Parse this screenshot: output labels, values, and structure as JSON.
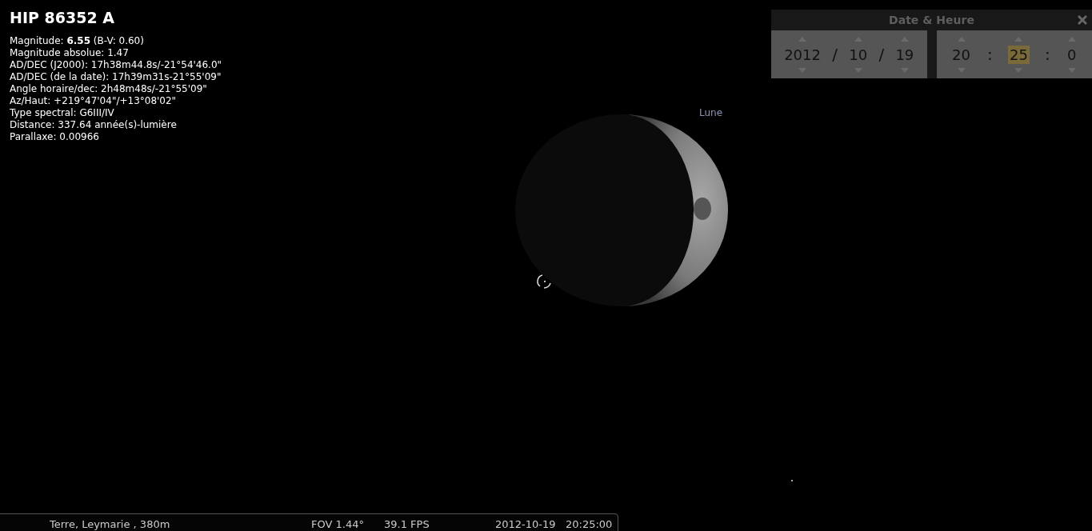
{
  "object_info": {
    "title": "HIP 86352 A",
    "lines": [
      "Magnitude: **6.55** (B-V: 0.60)",
      "Magnitude absolue: 1.47",
      "AD/DEC (J2000): 17h38m44.8s/-21°54'46.0\"",
      "AD/DEC (de la date): 17h39m31s-21°55'09\"",
      "Angle horaire/dec: 2h48m48s/-21°55'09\"",
      "Az/Haut: +219°47'04\"/+13°08'02\"",
      "Type spectral: G6III/IV",
      "Distance: 337.64 année(s)-lumière",
      "Parallaxe: 0.00966"
    ]
  },
  "moon": {
    "label": "Lune"
  },
  "date_dialog": {
    "title": "Date & Heure",
    "date_fields": [
      {
        "value": "2012",
        "selected": false
      },
      {
        "value": "10",
        "selected": false
      },
      {
        "value": "19",
        "selected": false
      }
    ],
    "date_separators": [
      "/",
      "/"
    ],
    "time_fields": [
      {
        "value": "20",
        "selected": false
      },
      {
        "value": "25",
        "selected": true
      },
      {
        "value": "0",
        "selected": false
      }
    ],
    "time_separators": [
      ":",
      ":"
    ]
  },
  "status_bar": {
    "location": "Terre, Leymarie , 380m",
    "fov": "FOV 1.44°",
    "fps": "39.1 FPS",
    "date": "2012-10-19",
    "time": "20:25:00"
  }
}
